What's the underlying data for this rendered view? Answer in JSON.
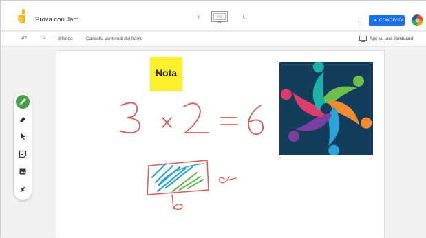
{
  "header": {
    "title": "Prova con Jam",
    "share_label": "CONDIVIDI",
    "more_icon": "more-vert-icon",
    "colors": {
      "share": "#1a73e8",
      "logo": "#f7b500"
    }
  },
  "toolbar": {
    "background_label": "Sfondo",
    "clear_label": "Cancella contenuti del frame",
    "open_label": "Apri su una Jamboard"
  },
  "tools": [
    "pen-icon",
    "eraser-icon",
    "select-icon",
    "sticky-note-icon",
    "image-icon",
    "laser-icon"
  ],
  "canvas": {
    "sticky_note": {
      "text": "Nota",
      "color": "#fbef2e"
    },
    "handwriting": "3 × 2 = 6",
    "labels": [
      "a",
      "b"
    ],
    "ink_color": "#d9534f"
  }
}
